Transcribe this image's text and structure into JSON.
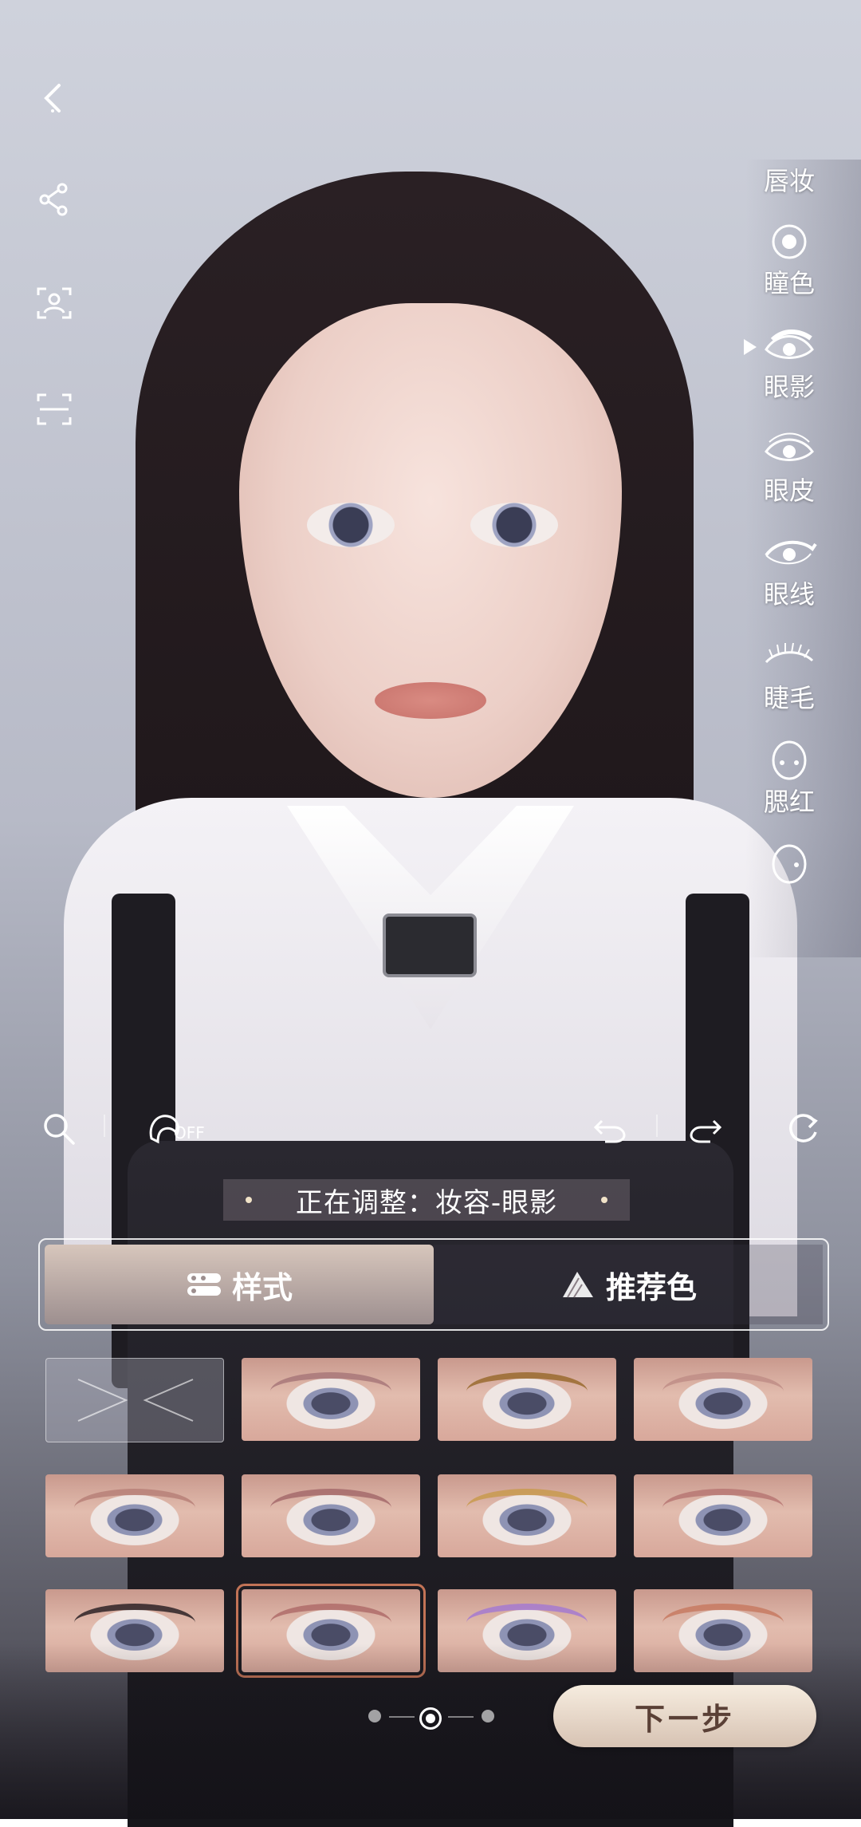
{
  "left_toolbar": {
    "icons": [
      "back-icon",
      "share-icon",
      "face-scan-icon",
      "scan-frame-icon"
    ]
  },
  "categories": [
    {
      "label": "唇妆",
      "icon": ""
    },
    {
      "label": "瞳色",
      "icon": "pupil-icon"
    },
    {
      "label": "眼影",
      "icon": "eyeshadow-icon",
      "selected": true
    },
    {
      "label": "眼皮",
      "icon": "eyelid-icon"
    },
    {
      "label": "眼线",
      "icon": "eyeliner-icon"
    },
    {
      "label": "睫毛",
      "icon": "eyelash-icon"
    },
    {
      "label": "腮红",
      "icon": "blush-icon"
    },
    {
      "label": "",
      "icon": "more-makeup-icon"
    }
  ],
  "toolbar": {
    "hair_toggle_state": "OFF",
    "icons": [
      "search-icon",
      "hair-toggle-icon",
      "undo-icon",
      "redo-icon",
      "reset-icon"
    ]
  },
  "status_text": "正在调整：妆容-眼影",
  "tabs": [
    {
      "label": "样式",
      "active": true
    },
    {
      "label": "推荐色",
      "active": false
    }
  ],
  "styles": {
    "columns": 4,
    "selected_index": 9,
    "items": [
      {
        "id": "none",
        "shade": ""
      },
      {
        "shade": "#a9787a"
      },
      {
        "shade": "#9a6b2f"
      },
      {
        "shade": "#c08e87"
      },
      {
        "shade": "#b88078"
      },
      {
        "shade": "#a56a6c"
      },
      {
        "shade": "#c89a4e"
      },
      {
        "shade": "#b87774"
      },
      {
        "shade": "#2d2326"
      },
      {
        "shade": "#b06d6a"
      },
      {
        "shade": "#a57bd1"
      },
      {
        "shade": "#c77b62"
      }
    ]
  },
  "pager": {
    "total": 3,
    "current": 2
  },
  "next_button": "下一步",
  "colors": {
    "accent": "#c27356",
    "next_text": "#5a4036"
  }
}
